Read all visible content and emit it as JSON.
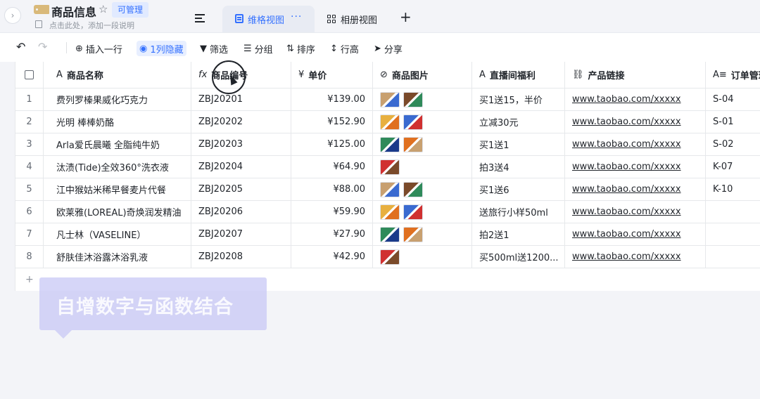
{
  "header": {
    "title": "商品信息",
    "manage_badge": "可管理",
    "description_placeholder": "点击此处，添加一段说明",
    "collapse_icon": "›"
  },
  "views": {
    "grid": {
      "label": "维格视图",
      "more": "···"
    },
    "album": {
      "label": "相册视图"
    },
    "add": "+"
  },
  "toolbar": {
    "insert_row": "插入一行",
    "hidden_cols": "1列隐藏",
    "filter": "筛选",
    "group": "分组",
    "sort": "排序",
    "row_height": "行高",
    "share": "分享"
  },
  "columns": [
    {
      "icon": "A",
      "label": "商品名称"
    },
    {
      "icon": "fx",
      "label": "商品编号"
    },
    {
      "icon": "¥",
      "label": "单价"
    },
    {
      "icon": "⊘",
      "label": "商品图片"
    },
    {
      "icon": "A",
      "label": "直播间福利"
    },
    {
      "icon": "⛓",
      "label": "产品链接"
    },
    {
      "icon": "A≡",
      "label": "订单管理"
    }
  ],
  "rows": [
    {
      "idx": "1",
      "name": "费列罗榛果威化巧克力",
      "code": "ZBJ20201",
      "price": "¥139.00",
      "benefit": "买1送15，半价",
      "link": "www.taobao.com/xxxxx",
      "order": "S-04",
      "thumbs": 2
    },
    {
      "idx": "2",
      "name": "光明 棒棒奶酪",
      "code": "ZBJ20202",
      "price": "¥152.90",
      "benefit": "立减30元",
      "link": "www.taobao.com/xxxxx",
      "order": "S-01",
      "thumbs": 2
    },
    {
      "idx": "3",
      "name": "Arla爱氏晨曦 全脂纯牛奶",
      "code": "ZBJ20203",
      "price": "¥125.00",
      "benefit": "买1送1",
      "link": "www.taobao.com/xxxxx",
      "order": "S-02",
      "thumbs": 2
    },
    {
      "idx": "4",
      "name": "汰渍(Tide)全效360°洗衣液",
      "code": "ZBJ20204",
      "price": "¥64.90",
      "benefit": "拍3送4",
      "link": "www.taobao.com/xxxxx",
      "order": "K-07",
      "thumbs": 1
    },
    {
      "idx": "5",
      "name": "江中猴姑米稀早餐麦片代餐",
      "code": "ZBJ20205",
      "price": "¥88.00",
      "benefit": "买1送6",
      "link": "www.taobao.com/xxxxx",
      "order": "K-10",
      "thumbs": 2
    },
    {
      "idx": "6",
      "name": "欧莱雅(LOREAL)奇焕润发精油",
      "code": "ZBJ20206",
      "price": "¥59.90",
      "benefit": "送旅行小样50ml",
      "link": "www.taobao.com/xxxxx",
      "order": "",
      "thumbs": 2
    },
    {
      "idx": "7",
      "name": "凡士林（VASELINE）",
      "code": "ZBJ20207",
      "price": "¥27.90",
      "benefit": "拍2送1",
      "link": "www.taobao.com/xxxxx",
      "order": "",
      "thumbs": 2
    },
    {
      "idx": "8",
      "name": "舒肤佳沐浴露沐浴乳液",
      "code": "ZBJ20208",
      "price": "¥42.90",
      "benefit": "买500ml送1200...",
      "link": "www.taobao.com/xxxxx",
      "order": "",
      "thumbs": 1
    }
  ],
  "add_row": "+",
  "tooltip": "自增数字与函数结合",
  "colors": {
    "accent": "#3370ff",
    "tooltip_bg": "#c8c8f5",
    "thumb_palette": [
      "#c8a070",
      "#7a4a2a",
      "#e8b040",
      "#3a6ad0",
      "#2f8a5a",
      "#e07020",
      "#d03030",
      "#1a3a8a"
    ]
  }
}
